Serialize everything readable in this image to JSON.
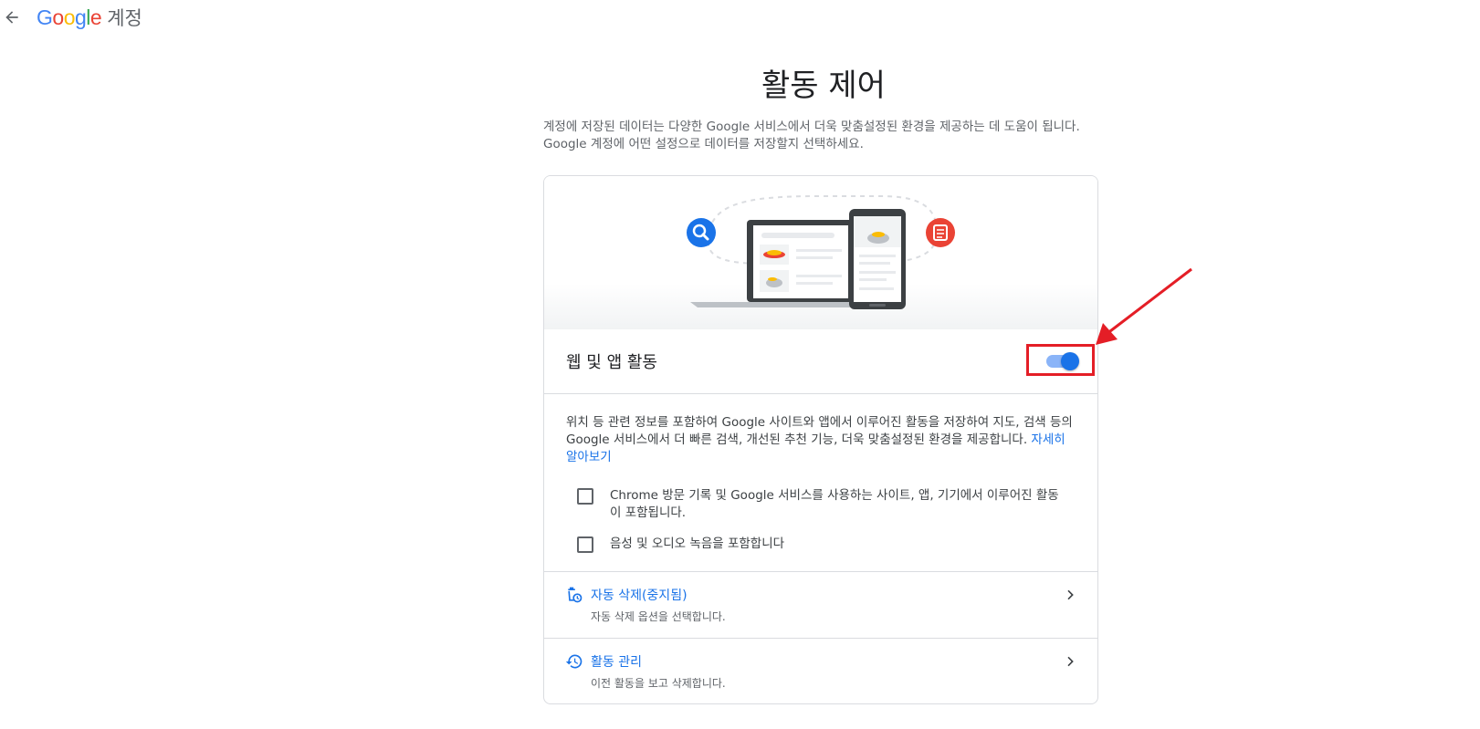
{
  "header": {
    "back_label": "←",
    "logo_letters": [
      "G",
      "o",
      "o",
      "g",
      "l",
      "e"
    ],
    "product": "계정"
  },
  "page": {
    "title": "활동 제어",
    "intro": "계정에 저장된 데이터는 다양한 Google 서비스에서 더욱 맞춤설정된 환경을 제공하는 데 도움이 됩니다. Google 계정에 어떤 설정으로 데이터를 저장할지 선택하세요."
  },
  "card": {
    "toggle_label": "웹 및 앱 활동",
    "toggle_on": true,
    "description": "위치 등 관련 정보를 포함하여 Google 사이트와 앱에서 이루어진 활동을 저장하여 지도, 검색 등의 Google 서비스에서 더 빠른 검색, 개선된 추천 기능, 더욱 맞춤설정된 환경을 제공합니다. ",
    "learn_more": "자세히 알아보기",
    "checkboxes": [
      {
        "label": "Chrome 방문 기록 및 Google 서비스를 사용하는 사이트, 앱, 기기에서 이루어진 활동이 포함됩니다.",
        "checked": false
      },
      {
        "label": "음성 및 오디오 녹음을 포함합니다",
        "checked": false
      }
    ],
    "links": [
      {
        "title": "자동 삭제(중지됨)",
        "subtitle": "자동 삭제 옵션을 선택합니다.",
        "icon": "auto-delete-icon"
      },
      {
        "title": "활동 관리",
        "subtitle": "이전 활동을 보고 삭제합니다.",
        "icon": "history-icon"
      }
    ]
  },
  "colors": {
    "accent": "#1a73e8",
    "annotation": "#e41e26"
  }
}
